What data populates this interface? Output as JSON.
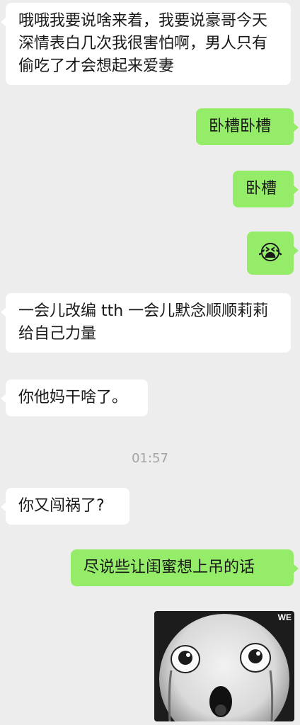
{
  "messages": [
    {
      "side": "in",
      "text": "哦哦我要说啥来着，我要说豪哥今天深情表白几次我很害怕啊，男人只有偷吃了才会想起来爱妻"
    },
    {
      "side": "out",
      "text": "卧槽卧槽"
    },
    {
      "side": "out",
      "text": "卧槽"
    },
    {
      "side": "out",
      "emoji": "😭"
    },
    {
      "side": "in",
      "text": "一会儿改编 tth 一会儿默念顺顺莉莉给自己力量"
    },
    {
      "side": "in",
      "text": "你他妈干啥了。"
    },
    {
      "side": "in",
      "text": "你又闯祸了?"
    },
    {
      "side": "out",
      "text": "尽说些让闺蜜想上吊的话"
    }
  ],
  "timestamp": "01:57",
  "sticker": {
    "icon": "crying-face-sticker",
    "watermark": "WE"
  }
}
